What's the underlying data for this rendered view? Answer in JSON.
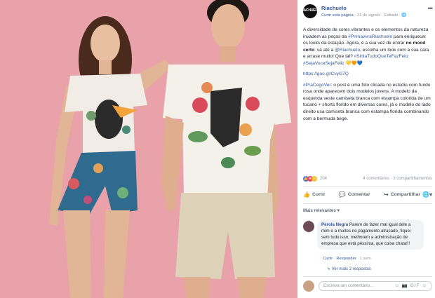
{
  "post_image": {
    "description_icon": "photo-two-models-icon"
  },
  "page": {
    "name": "Riachuelo",
    "logo_text": "RIACHUELO",
    "meta_curtir": "Curtir esta página",
    "meta_date": " · 21 de agosto · Editado · ",
    "meta_globe": "🌐"
  },
  "post": {
    "p1_a": "A diversidade de cores vibrantes e os elementos da natureza invadem as peças da ",
    "p1_hashtag": "#PrimaveraRiachuelo",
    "p1_b": " para enriquecer os looks da estação. Agora, é a sua vez de entrar ",
    "p1_bold": "no mood certo",
    "p1_c": ": vá até a ",
    "p1_mention": "@Riachuelo",
    "p1_d": ", escolha um look com a sua cara e arrase muito! Que tal? ",
    "p1_tags": "#SintaTudoQueTeFazFeliz #SejaVoceSejaFeliz",
    "p1_hearts": "💛🧡💙",
    "link": "https://goo.gl/CvyG7Q",
    "p3_tag": "#PraCegoVer",
    "p3_text": ": o post é uma foto clicada no estúdio com fundo rosa onde aparecem dois modelos jovens. A modelo da esquerda veste camiseta branca com estampa colorida de um tucano + shorts florido em diversas cores, já o modelo do lado direito usa camiseta branca com estampa florida combinando com a bermuda bege."
  },
  "stats": {
    "reactions_count": "204",
    "comments_shares": "4 comentários · 3 compartilhamentos"
  },
  "actions": {
    "like": "Curtir",
    "comment": "Comentar",
    "share": "Compartilhar"
  },
  "comments": {
    "filter": "Mais relevantes ▾",
    "items": [
      {
        "author": "Pérola Negra",
        "text": " Parem de fazer mal igual dele a mim e a muitos no pagamento atrasado, fiquei sem tudo isso, melhorem a administração de empresa que está péssima, que coisa chata!!!",
        "like": "Curtir",
        "reply": "Responder",
        "time": "1 sem"
      }
    ],
    "view_replies": "↳ Ver mais 2 respostas"
  },
  "composer": {
    "placeholder": "Escreva um comentário...",
    "icons": "☺ 📷 GIF ☺"
  },
  "colors": {
    "background_photo": "#e9a2a9",
    "link": "#365899",
    "muted": "#90949c"
  }
}
